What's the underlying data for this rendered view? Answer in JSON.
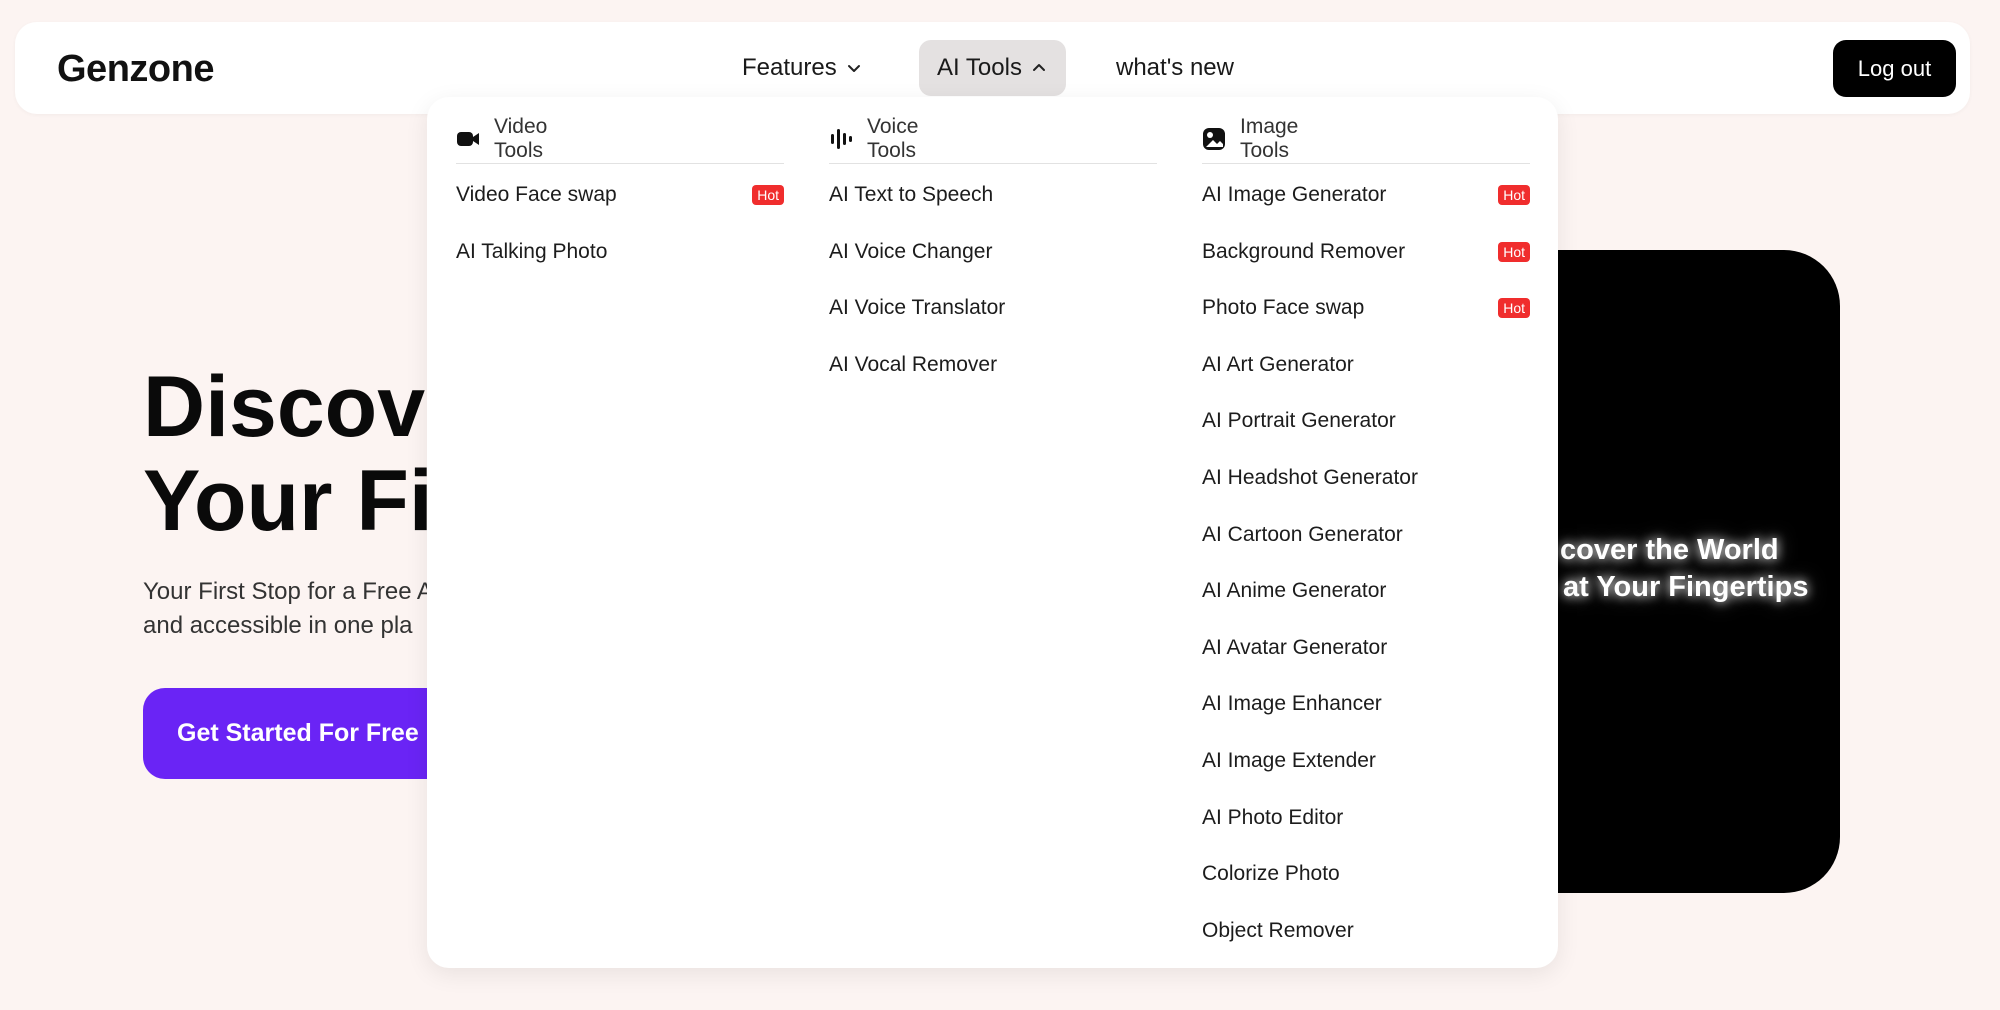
{
  "header": {
    "logo": "Genzone",
    "nav": [
      {
        "label": "Features"
      },
      {
        "label": "AI Tools"
      },
      {
        "label": "what's new"
      }
    ],
    "logout_label": "Log out"
  },
  "hero": {
    "title_line1": "Discove",
    "title_line2": "Your Fi",
    "subtitle_line1": "Your First Stop for a Free A",
    "subtitle_line2": "and accessible in one pla",
    "cta_label": "Get Started For Free",
    "video_caption_line1": "cover the World",
    "video_caption_line2": "at Your Fingertips"
  },
  "dropdown": {
    "hot_label": "Hot",
    "columns": [
      {
        "title": "Video Tools",
        "icon": "video-camera-icon",
        "items": [
          {
            "label": "Video Face swap",
            "hot": true
          },
          {
            "label": "AI Talking Photo",
            "hot": false
          }
        ]
      },
      {
        "title": "Voice Tools",
        "icon": "audio-waveform-icon",
        "items": [
          {
            "label": "AI Text to Speech",
            "hot": false
          },
          {
            "label": "AI Voice Changer",
            "hot": false
          },
          {
            "label": "AI Voice Translator",
            "hot": false
          },
          {
            "label": "AI Vocal Remover",
            "hot": false
          }
        ]
      },
      {
        "title": "Image Tools",
        "icon": "image-icon",
        "items": [
          {
            "label": "AI Image Generator",
            "hot": true
          },
          {
            "label": "Background Remover",
            "hot": true
          },
          {
            "label": "Photo Face swap",
            "hot": true
          },
          {
            "label": "AI Art Generator",
            "hot": false
          },
          {
            "label": "AI Portrait Generator",
            "hot": false
          },
          {
            "label": "AI Headshot Generator",
            "hot": false
          },
          {
            "label": "AI Cartoon Generator",
            "hot": false
          },
          {
            "label": "AI Anime Generator",
            "hot": false
          },
          {
            "label": "AI Avatar Generator",
            "hot": false
          },
          {
            "label": "AI Image Enhancer",
            "hot": false
          },
          {
            "label": "AI Image Extender",
            "hot": false
          },
          {
            "label": "AI Photo Editor",
            "hot": false
          },
          {
            "label": "Colorize Photo",
            "hot": false
          },
          {
            "label": "Object Remover",
            "hot": false
          }
        ]
      }
    ]
  },
  "colors": {
    "page_bg": "#fcf4f2",
    "accent": "#6a24f5",
    "hot_badge": "#f02d2d"
  }
}
